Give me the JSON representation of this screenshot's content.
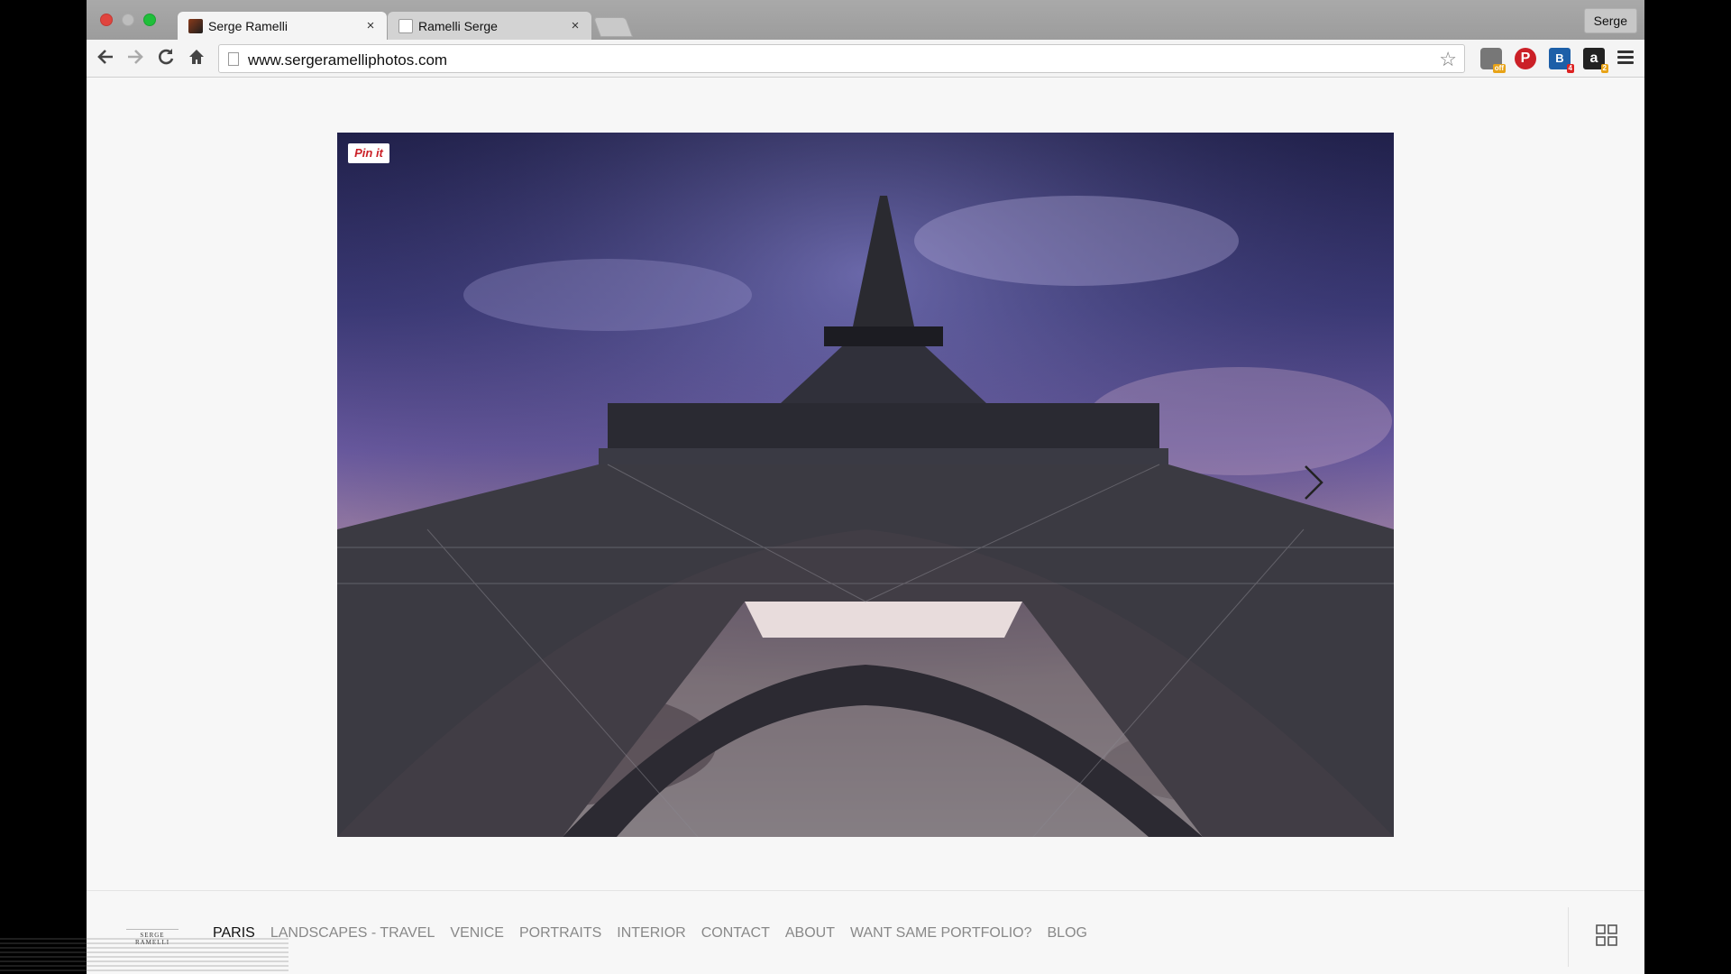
{
  "browser": {
    "tabs": [
      {
        "title": "Serge Ramelli",
        "close": "×"
      },
      {
        "title": "Ramelli Serge",
        "close": "×"
      }
    ],
    "profile": "Serge",
    "url": "www.sergeramelliphotos.com",
    "extensions": {
      "pinterest": "P",
      "b_ext": "B",
      "b_badge": "4",
      "amazon": "a",
      "amazon_badge": "2",
      "camera_badge": "off"
    }
  },
  "photo": {
    "pinit_label": "Pin it"
  },
  "footer": {
    "logo_text": "SERGE RAMELLI",
    "nav": [
      "PARIS",
      "LANDSCAPES - TRAVEL",
      "VENICE",
      "PORTRAITS",
      "INTERIOR",
      "CONTACT",
      "ABOUT",
      "WANT SAME PORTFOLIO?",
      "BLOG"
    ]
  },
  "colors": {
    "pinterest_red": "#cb2027",
    "nav_active": "#111111",
    "nav_inactive": "#888888"
  }
}
